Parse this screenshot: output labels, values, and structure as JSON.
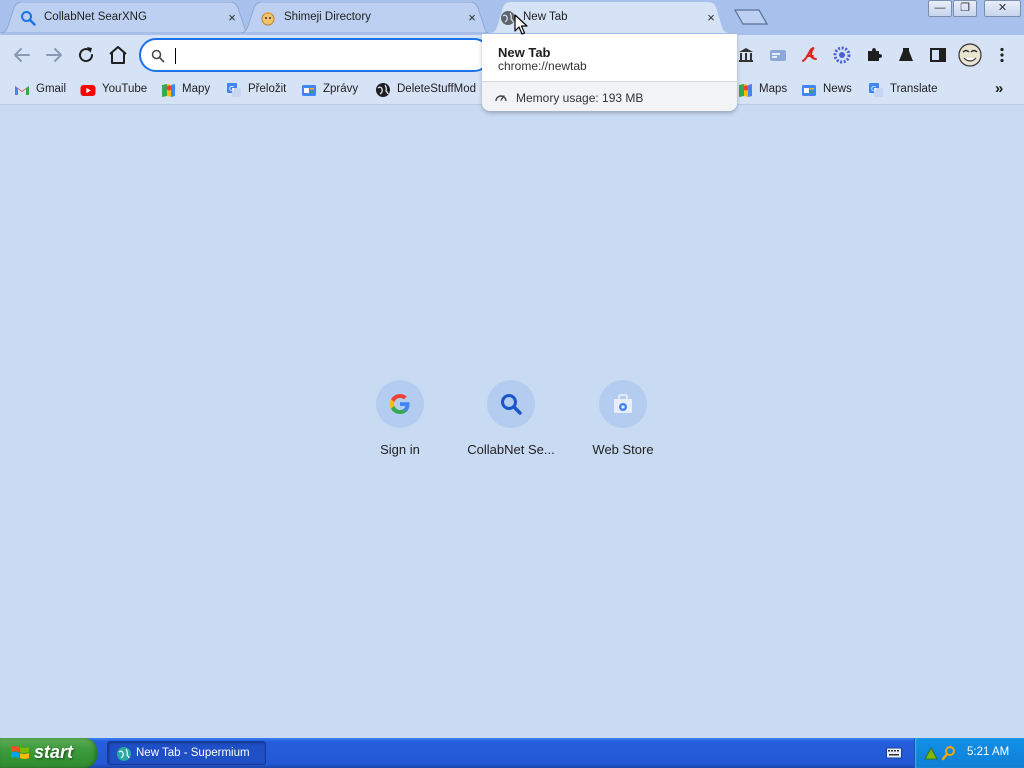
{
  "tabs": [
    {
      "title": "CollabNet SearXNG",
      "favicon": "search-icon"
    },
    {
      "title": "Shimeji Directory",
      "favicon": "shimeji-icon"
    },
    {
      "title": "New Tab",
      "favicon": "globe-icon",
      "active": true
    }
  ],
  "tab_close_glyph": "×",
  "window_controls": {
    "minimize": "—",
    "restore": "❐",
    "close": "✕"
  },
  "omnibox": {
    "value": "",
    "placeholder": ""
  },
  "extensions": [
    "library-icon",
    "card-icon",
    "adobe-icon",
    "gear-extension-icon",
    "puzzle-icon",
    "flask-icon",
    "sidepanel-icon",
    "profile-avatar",
    "more-icon"
  ],
  "bookmarks_left": [
    {
      "label": "Gmail",
      "icon": "gmail-icon"
    },
    {
      "label": "YouTube",
      "icon": "youtube-icon"
    },
    {
      "label": "Mapy",
      "icon": "maps-icon"
    },
    {
      "label": "Přeložit",
      "icon": "translate-icon"
    },
    {
      "label": "Zprávy",
      "icon": "news-icon"
    },
    {
      "label": "DeleteStuffMod",
      "icon": "globe-icon"
    }
  ],
  "bookmarks_right": [
    {
      "label": "Maps",
      "icon": "maps-icon"
    },
    {
      "label": "News",
      "icon": "news-icon"
    },
    {
      "label": "Translate",
      "icon": "translate-icon"
    }
  ],
  "bookmarks_overflow": "»",
  "hover_card": {
    "title": "New Tab",
    "url": "chrome://newtab",
    "memory": "Memory usage: 193 MB"
  },
  "shortcuts": [
    {
      "label": "Sign in",
      "icon": "google-icon"
    },
    {
      "label": "CollabNet Se...",
      "icon": "search-icon"
    },
    {
      "label": "Web Store",
      "icon": "webstore-icon"
    }
  ],
  "taskbar": {
    "start_label": "start",
    "window_label": "New Tab - Supermium",
    "clock": "5:21 AM"
  },
  "colors": {
    "accent": "#1a73e8",
    "page_background": "#c9dbf3",
    "taskbar": "#245edb",
    "start_button": "#3c9b3a"
  }
}
